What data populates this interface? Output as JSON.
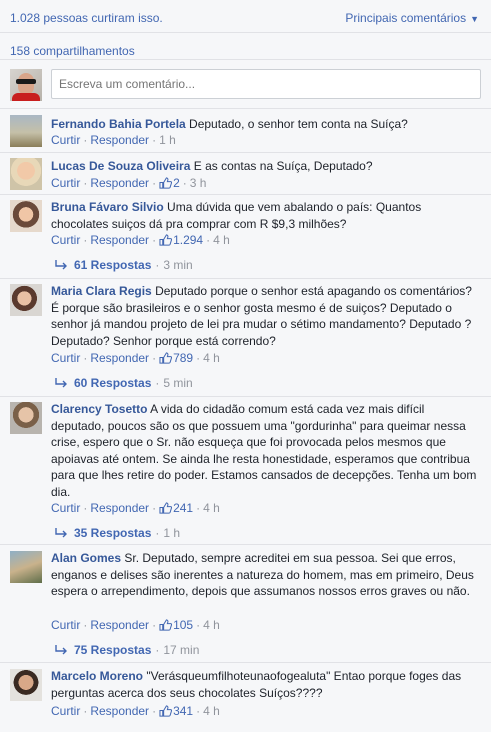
{
  "header": {
    "likes_text": "1.028 pessoas curtiram isso.",
    "sort_label": "Principais comentários",
    "shares_text": "158 compartilhamentos"
  },
  "composer": {
    "placeholder": "Escreva um comentário..."
  },
  "action_labels": {
    "like": "Curtir",
    "reply": "Responder",
    "separator": "·"
  },
  "colors": {
    "link": "#4267b2",
    "author": "#365899",
    "meta": "#90949c",
    "background": "#f6f7f9"
  },
  "comments": [
    {
      "author": "Fernando Bahia Portela",
      "text": "Deputado, o senhor tem conta na Suíça?",
      "likes": "",
      "time": "1 h",
      "replies": ""
    },
    {
      "author": "Lucas De Souza Oliveira",
      "text": "E as contas na Suíça, Deputado?",
      "likes": "2",
      "time": "3 h",
      "replies": ""
    },
    {
      "author": "Bruna Fávaro Silvio",
      "text": "Uma dúvida que vem abalando o país: Quantos chocolates suiços dá pra comprar com R $9,3 milhões?",
      "likes": "1.294",
      "time": "4 h",
      "replies": "61 Respostas",
      "replies_time": "3 min"
    },
    {
      "author": "Maria Clara Regis",
      "text": "Deputado porque o senhor está apagando os comentários? É porque são brasileiros e o senhor gosta mesmo é de suiços? Deputado o senhor já mandou projeto de lei pra mudar o sétimo mandamento? Deputado ? Deputado? Senhor porque está correndo?",
      "likes": "789",
      "time": "4 h",
      "replies": "60 Respostas",
      "replies_time": "5 min"
    },
    {
      "author": "Clarency Tosetto",
      "text": "A vida do cidadão comum está cada vez mais difícil deputado, poucos são os que possuem uma \"gordurinha\" para queimar nessa crise, espero que o Sr. não esqueça que foi provocada pelos mesmos que apoiavas até ontem. Se ainda lhe resta honestidade, esperamos que contribua para que lhes retire do poder. Estamos cansados de decepções. Tenha um bom dia.",
      "likes": "241",
      "time": "4 h",
      "replies": "35 Respostas",
      "replies_time": "1 h"
    },
    {
      "author": "Alan Gomes",
      "text": "Sr. Deputado, sempre acreditei em sua pessoa. Sei que erros, enganos e delises são inerentes a natureza do homem, mas em primeiro, Deus espera o arrependimento, depois que assumanos nossos erros graves ou não.",
      "likes": "105",
      "time": "4 h",
      "replies": "75 Respostas",
      "replies_time": "17 min"
    },
    {
      "author": "Marcelo Moreno",
      "text": "\"Verásqueumfilhoteunaofogealuta\" Entao porque foges das perguntas acerca dos seus chocolates Suíços????",
      "likes": "341",
      "time": "4 h",
      "replies": ""
    }
  ]
}
